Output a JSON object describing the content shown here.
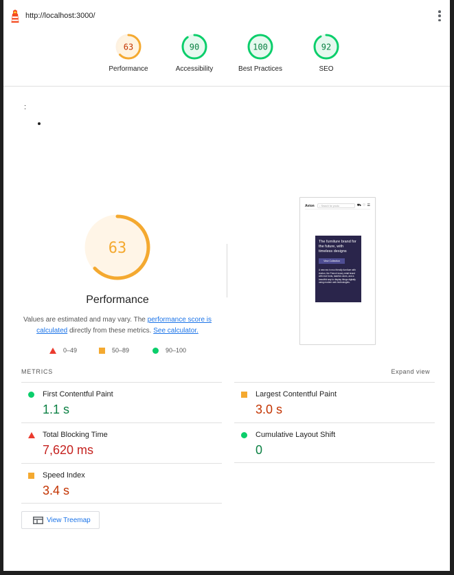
{
  "header": {
    "url": "http://localhost:3000/"
  },
  "summary_gauges": [
    {
      "label": "Performance",
      "score": 63,
      "color": "#f4a930",
      "text_color": "#c33300"
    },
    {
      "label": "Accessibility",
      "score": 90,
      "color": "#0bce6b",
      "text_color": "#0b8043"
    },
    {
      "label": "Best Practices",
      "score": 100,
      "color": "#0bce6b",
      "text_color": "#0b8043"
    },
    {
      "label": "SEO",
      "score": 92,
      "color": "#0bce6b",
      "text_color": "#0b8043"
    }
  ],
  "misc": {
    "colon": ":"
  },
  "performance": {
    "score": "63",
    "title": "Performance",
    "desc_prefix": "Values are estimated and may vary. The ",
    "desc_link1": "performance score is calculated",
    "desc_mid": " directly from these metrics. ",
    "desc_link2": "See calculator."
  },
  "legend": [
    {
      "shape": "triangle",
      "range": "0–49",
      "color": "#eb3b2e"
    },
    {
      "shape": "square",
      "range": "50–89",
      "color": "#f4a930"
    },
    {
      "shape": "circle",
      "range": "90–100",
      "color": "#0bce6b"
    }
  ],
  "thumbnail": {
    "brand": "Avion",
    "search_placeholder": "Search for produ",
    "hero_title": "The furniture brand for the future, with timeless designs",
    "hero_button": "View Collection",
    "hero_text": "A new era in eco friendly furniture with Avelon, the French luxury retail brand with nice fonts, tasteful colors, and a beautiful way to display things digitally using modern web technologies."
  },
  "metrics": {
    "heading": "METRICS",
    "expand_label": "Expand view",
    "left": [
      {
        "name": "First Contentful Paint",
        "value": "1.1 s",
        "status": "pass"
      },
      {
        "name": "Total Blocking Time",
        "value": "7,620 ms",
        "status": "fail"
      },
      {
        "name": "Speed Index",
        "value": "3.4 s",
        "status": "average"
      }
    ],
    "right": [
      {
        "name": "Largest Contentful Paint",
        "value": "3.0 s",
        "status": "average"
      },
      {
        "name": "Cumulative Layout Shift",
        "value": "0",
        "status": "pass"
      }
    ]
  },
  "treemap_button": {
    "label": "View Treemap"
  }
}
